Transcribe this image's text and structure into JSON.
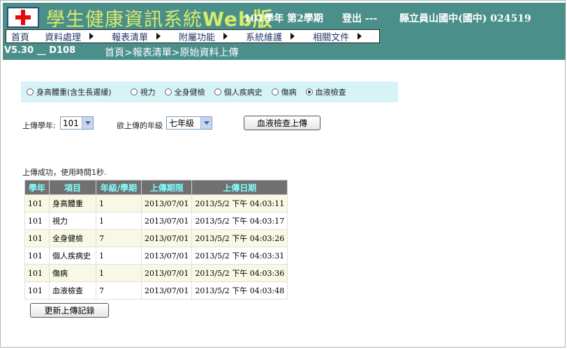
{
  "header": {
    "system_title": "學生健康資訊系統",
    "system_title_web": "Web版",
    "semester": "101學年 第2學期",
    "logout": "登出 ---",
    "school": "縣立員山國中(國中) 024519",
    "version": "V5.30 __ D108",
    "breadcrumb": "首頁>報表清單>原始資料上傳"
  },
  "menu": {
    "items": [
      {
        "label": "首頁"
      },
      {
        "label": "資料處理"
      },
      {
        "label": "報表清單"
      },
      {
        "label": "附屬功能"
      },
      {
        "label": "系統維護"
      },
      {
        "label": "相關文件"
      }
    ]
  },
  "radios": {
    "options": [
      {
        "label": "身高體重(含生長遲緩)",
        "checked": false
      },
      {
        "label": "視力",
        "checked": false
      },
      {
        "label": "全身健檢",
        "checked": false
      },
      {
        "label": "個人疾病史",
        "checked": false
      },
      {
        "label": "傷病",
        "checked": false
      },
      {
        "label": "血液檢查",
        "checked": true
      }
    ]
  },
  "form": {
    "year_label": "上傳學年:",
    "year_value": "101",
    "grade_label": "欲上傳的年級",
    "grade_value": "七年級",
    "upload_button": "血液檢查上傳",
    "refresh_button": "更新上傳記錄"
  },
  "status_message": "上傳成功，使用時間1秒.",
  "table": {
    "headers": [
      "學年",
      "項目",
      "年級/學期",
      "上傳期限",
      "上傳日期"
    ],
    "rows": [
      [
        "101",
        "身高體重",
        "1",
        "2013/07/01",
        "2013/5/2 下午 04:03:11"
      ],
      [
        "101",
        "視力",
        "1",
        "2013/07/01",
        "2013/5/2 下午 04:03:17"
      ],
      [
        "101",
        "全身健檢",
        "7",
        "2013/07/01",
        "2013/5/2 下午 04:03:26"
      ],
      [
        "101",
        "個人疾病史",
        "1",
        "2013/07/01",
        "2013/5/2 下午 04:03:31"
      ],
      [
        "101",
        "傷病",
        "1",
        "2013/07/01",
        "2013/5/2 下午 04:03:36"
      ],
      [
        "101",
        "血液檢查",
        "7",
        "2013/07/01",
        "2013/5/2 下午 04:03:48"
      ]
    ]
  }
}
